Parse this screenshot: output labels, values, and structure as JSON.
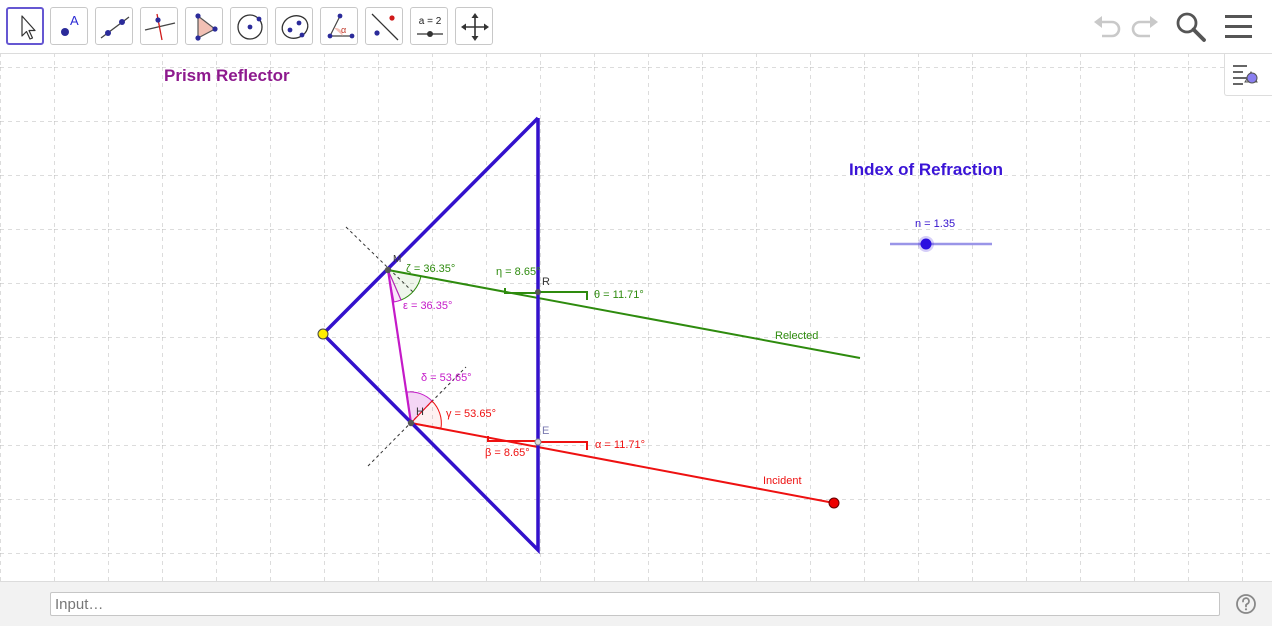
{
  "toolbar": {
    "tools": [
      {
        "id": "move",
        "icon": "move-arrow-icon",
        "active": true
      },
      {
        "id": "point",
        "icon": "point-icon",
        "label": "A"
      },
      {
        "id": "line",
        "icon": "line-icon"
      },
      {
        "id": "perpendicular",
        "icon": "perpendicular-line-icon"
      },
      {
        "id": "polygon",
        "icon": "polygon-icon"
      },
      {
        "id": "circle",
        "icon": "circle-icon"
      },
      {
        "id": "ellipse",
        "icon": "ellipse-icon"
      },
      {
        "id": "angle",
        "icon": "angle-icon",
        "label": "α"
      },
      {
        "id": "reflect",
        "icon": "reflect-icon"
      },
      {
        "id": "slider",
        "icon": "slider-icon",
        "label": "a = 2"
      },
      {
        "id": "move-view",
        "icon": "move-graphics-view-icon"
      }
    ],
    "right_icons": [
      "undo-icon",
      "redo-icon",
      "search-icon",
      "menu-icon"
    ]
  },
  "sidebar_icon": "algebra-style-bar-icon",
  "canvas": {
    "title": "Prism Reflector",
    "index_title": "Index of Refraction",
    "slider": {
      "name": "n",
      "value": 1.35,
      "label": "n = 1.35"
    },
    "points": {
      "M": "M",
      "R": "R",
      "H": "H",
      "E": "E"
    },
    "angles": {
      "zeta": "ζ = 36.35°",
      "epsilon": "ε = 36.35°",
      "eta": "η = 8.65°",
      "theta": "θ = 11.71°",
      "delta": "δ = 53.65°",
      "gamma": "γ = 53.65°",
      "beta": "β = 8.65°",
      "alpha": "α = 11.71°"
    },
    "ray_labels": {
      "reflected": "Relected",
      "incident": "Incident"
    },
    "colors": {
      "prism": "#3311cc",
      "reflected": "#2e8b0e",
      "incident": "#ee1111",
      "internal": "#c41ac8",
      "title": "#8e1a8e",
      "index_title": "#3a14d6",
      "vertex": "#ffee00"
    }
  },
  "input": {
    "placeholder": "Input…",
    "value": ""
  },
  "help_icon": "help-icon"
}
